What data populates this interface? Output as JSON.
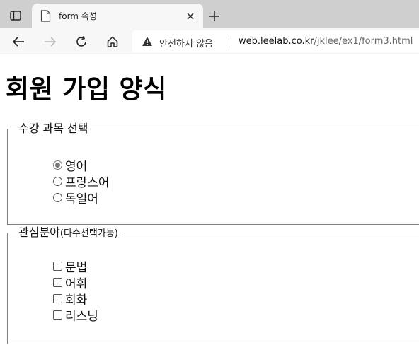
{
  "browser": {
    "tab": {
      "title": "form 속성"
    },
    "security_text": "안전하지 않음",
    "url": {
      "host": "web.leelab.co.kr",
      "path": "/jklee/ex1/form3.html"
    }
  },
  "page": {
    "title": "회원 가입 양식",
    "course_fieldset": {
      "legend": "수강 과목 선택",
      "options": [
        {
          "label": "영어",
          "checked": true
        },
        {
          "label": "프랑스어",
          "checked": false
        },
        {
          "label": "독일어",
          "checked": false
        }
      ]
    },
    "interest_fieldset": {
      "legend": "관심분야",
      "legend_note": "(다수선택가능)",
      "options": [
        {
          "label": "문법",
          "checked": false
        },
        {
          "label": "어휘",
          "checked": false
        },
        {
          "label": "회화",
          "checked": false
        },
        {
          "label": "리스닝",
          "checked": false
        }
      ]
    }
  }
}
